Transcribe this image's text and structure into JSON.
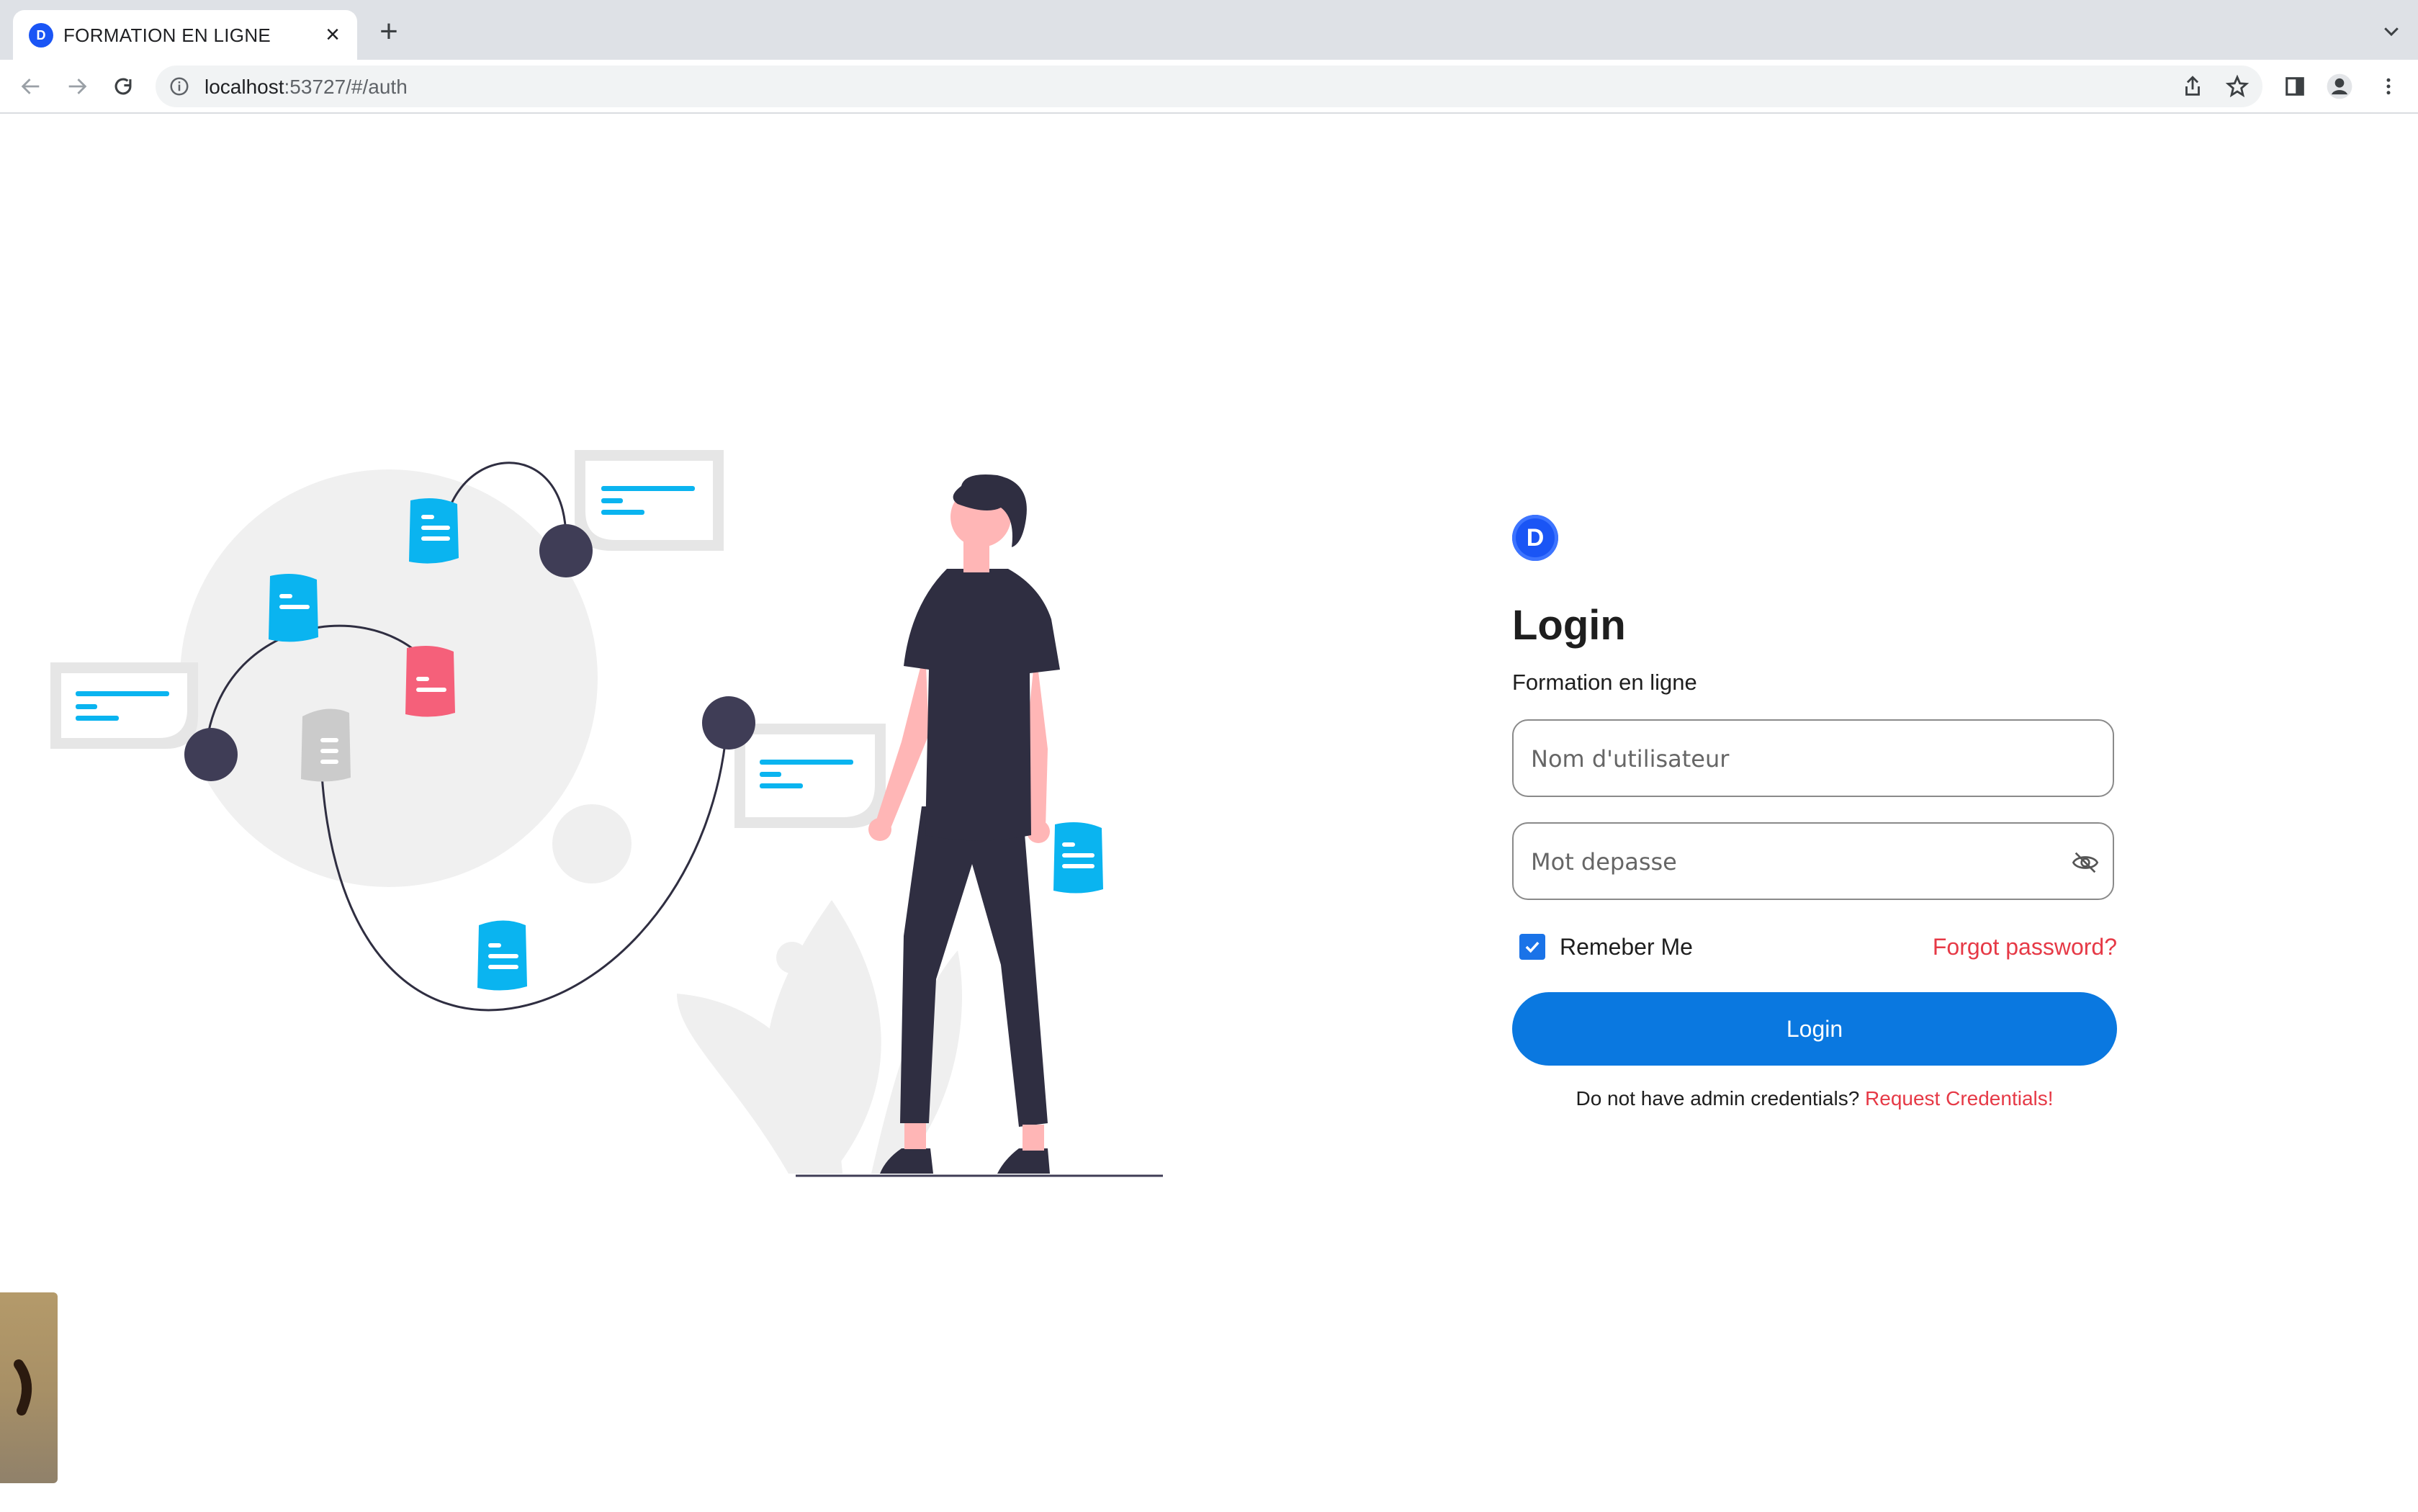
{
  "browser": {
    "tab_title": "FORMATION EN LIGNE",
    "tab_favicon_letter": "D",
    "url_host": "localhost",
    "url_path": ":53727/#/auth",
    "icons": [
      "back-icon",
      "forward-icon",
      "reload-icon",
      "info-icon",
      "share-icon",
      "star-icon",
      "sidebar-icon",
      "profile-icon",
      "menu-icon"
    ]
  },
  "login": {
    "logo_letter": "D",
    "title": "Login",
    "subtitle": "Formation en ligne",
    "username_placeholder": "Nom d'utilisateur",
    "password_placeholder": "Mot depasse",
    "remember_label": "Remeber Me",
    "remember_checked": true,
    "forgot_link": "Forgot password?",
    "button_label": "Login",
    "no_credentials_text": "Do not have admin credentials?",
    "request_link": "Request Credentials!"
  },
  "colors": {
    "primary": "#0a78e0",
    "brand": "#1a55f5",
    "link_red": "#e63946",
    "illustration_blue": "#0ab4f0",
    "illustration_pink": "#f5607a",
    "figure_dark": "#2f2e41"
  }
}
